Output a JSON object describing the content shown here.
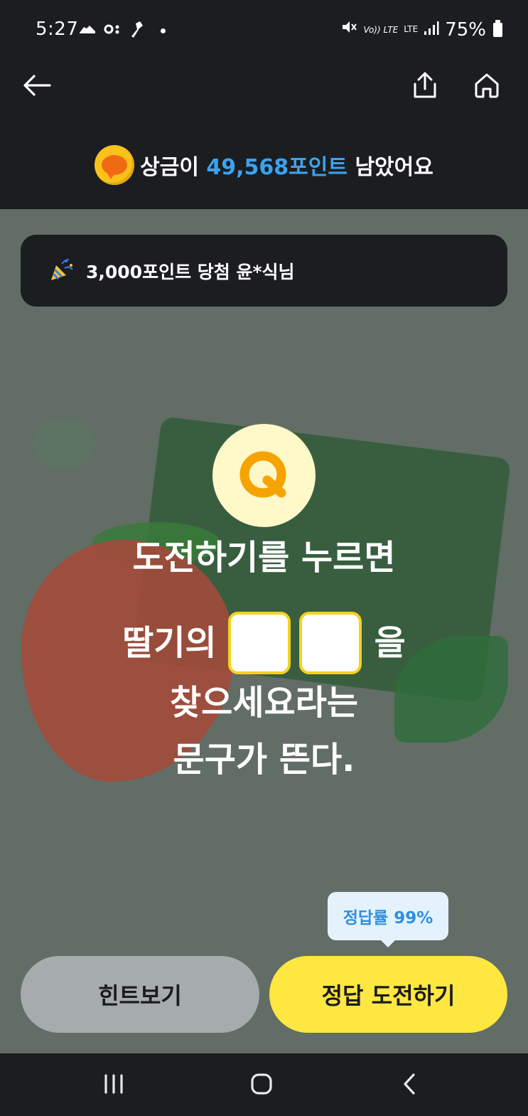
{
  "status_bar": {
    "time": "5:27",
    "network": "LTE",
    "volte": "Vo)) LTE",
    "battery": "75%",
    "icons": [
      "sneaker-icon",
      "link-icon",
      "tool-icon",
      "notification-dot-icon",
      "mute-icon",
      "signal-icon",
      "battery-icon"
    ]
  },
  "header": {
    "icons": {
      "back": "arrow-left-icon",
      "share": "share-icon",
      "home": "home-icon"
    },
    "prize": {
      "prefix": "상금이",
      "amount": "49,568포인트",
      "suffix": "남았어요",
      "accent_color": "#3ba3ef"
    }
  },
  "winner_banner": {
    "icon": "party-popper-icon",
    "text": "3,000포인트 당첨 윤*식님"
  },
  "quiz": {
    "badge": "Q",
    "line1": "도전하기를 누르면",
    "line2_before": "딸기의",
    "line2_after": "을",
    "blank_count": 2,
    "line3": "찾으세요라는",
    "line4": "문구가 뜬다."
  },
  "answer_rate": "정답률 99%",
  "buttons": {
    "hint": "힌트보기",
    "answer": "정답 도전하기"
  },
  "colors": {
    "dark": "#1b1d20",
    "overlay": "#626d66",
    "yellow": "#fde740",
    "grey_button": "#a6abae",
    "blank_border": "#f2d31b"
  },
  "nav_bar": {
    "icons": [
      "recent-apps-icon",
      "home-circle-icon",
      "back-chevron-icon"
    ]
  }
}
